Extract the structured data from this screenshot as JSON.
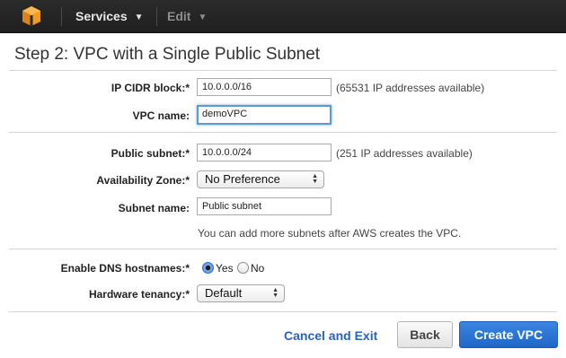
{
  "nav": {
    "services_label": "Services",
    "edit_label": "Edit",
    "logo_color": "#f29b22"
  },
  "page": {
    "title": "Step 2: VPC with a Single Public Subnet"
  },
  "form": {
    "ip_cidr": {
      "label": "IP CIDR block:*",
      "value": "10.0.0.0/16",
      "hint": "(65531 IP addresses available)"
    },
    "vpc_name": {
      "label": "VPC name:",
      "value": "demoVPC"
    },
    "public_subnet": {
      "label": "Public subnet:*",
      "value": "10.0.0.0/24",
      "hint": "(251 IP addresses available)"
    },
    "availability_zone": {
      "label": "Availability Zone:*",
      "selected": "No Preference"
    },
    "subnet_name": {
      "label": "Subnet name:",
      "value": "Public subnet"
    },
    "subnet_note": "You can add more subnets after AWS creates the VPC.",
    "dns_hostnames": {
      "label": "Enable DNS hostnames:*",
      "options": [
        "Yes",
        "No"
      ],
      "selected": "Yes"
    },
    "tenancy": {
      "label": "Hardware tenancy:*",
      "selected": "Default"
    }
  },
  "actions": {
    "cancel_label": "Cancel and Exit",
    "back_label": "Back",
    "create_label": "Create VPC"
  },
  "colors": {
    "accent": "#1f66c8",
    "link": "#2a62b5",
    "topbar": "#232323"
  }
}
